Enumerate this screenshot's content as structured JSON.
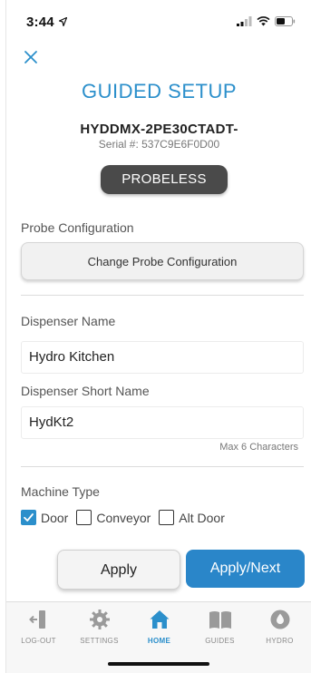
{
  "status_bar": {
    "time": "3:44"
  },
  "header": {
    "title": "GUIDED SETUP",
    "model": "HYDDMX-2PE30CTADT-",
    "serial": "Serial #: 537C9E6F0D00",
    "mode_badge": "PROBELESS"
  },
  "probe": {
    "section_label": "Probe Configuration",
    "button_label": "Change Probe Configuration"
  },
  "dispenser": {
    "name_label": "Dispenser Name",
    "name_value": "Hydro Kitchen",
    "short_name_label": "Dispenser Short Name",
    "short_name_value": "HydKt2",
    "short_name_hint": "Max 6 Characters"
  },
  "machine_type": {
    "label": "Machine Type",
    "options": [
      {
        "label": "Door",
        "checked": true
      },
      {
        "label": "Conveyor",
        "checked": false
      },
      {
        "label": "Alt Door",
        "checked": false
      }
    ]
  },
  "actions": {
    "apply": "Apply",
    "apply_next": "Apply/Next"
  },
  "tabs": [
    {
      "label": "LOG-OUT",
      "icon": "logout-icon",
      "active": false
    },
    {
      "label": "SETTINGS",
      "icon": "gear-icon",
      "active": false
    },
    {
      "label": "HOME",
      "icon": "home-icon",
      "active": true
    },
    {
      "label": "GUIDES",
      "icon": "book-icon",
      "active": false
    },
    {
      "label": "HYDRO",
      "icon": "drop-icon",
      "active": false
    }
  ],
  "colors": {
    "accent": "#2b8fcb",
    "badge": "#4a4a4a",
    "primary_button": "#2a86c9"
  }
}
